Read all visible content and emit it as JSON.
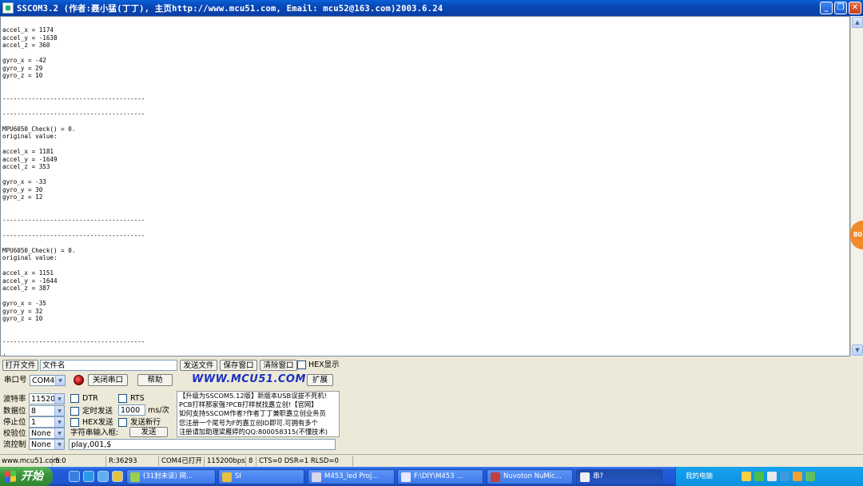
{
  "window": {
    "title": "SSCOM3.2 (作者:聂小猛(丁丁), 主页http://www.mcu51.com,  Email: mcu52@163.com)2003.6.24",
    "minimize": "_",
    "maximize": "❐",
    "close": "✕"
  },
  "output": {
    "text": "accel_x = 1174\naccel_y = -1638\naccel_z = 360\n\ngyro_x = -42\ngyro_y = 29\ngyro_z = 10\n\n\n---------------------------------------\n\n---------------------------------------\n\nMPU6050_Check() = 0.\noriginal value:\n\naccel_x = 1181\naccel_y = -1649\naccel_z = 353\n\ngyro_x = -33\ngyro_y = 30\ngyro_z = 12\n\n\n---------------------------------------\n\n---------------------------------------\n\nMPU6050_Check() = 0.\noriginal value:\n\naccel_x = 1151\naccel_y = -1644\naccel_z = 387\n\ngyro_x = -35\ngyro_y = 32\ngyro_z = 10\n\n\n---------------------------------------\n\n|"
  },
  "side_badge": "80",
  "toolbar": {
    "open_file": "打开文件",
    "file_name_value": "文件名",
    "send_file": "发送文件",
    "save_window": "保存窗口",
    "clear_window": "清除窗口",
    "hex_display": "HEX显示",
    "port_label": "串口号",
    "port_value": "COM4",
    "close_port": "关闭串口",
    "help": "帮助",
    "site_link": "WWW.MCU51.COM",
    "expand": "扩展"
  },
  "settings": {
    "baud_label": "波特率",
    "baud_value": "115200",
    "databits_label": "数据位",
    "databits_value": "8",
    "stopbits_label": "停止位",
    "stopbits_value": "1",
    "parity_label": "校验位",
    "parity_value": "None",
    "flow_label": "流控制",
    "flow_value": "None",
    "dtr": "DTR",
    "rts": "RTS",
    "timed_send": "定时发送",
    "interval_value": "1000",
    "interval_unit": "ms/次",
    "hex_send": "HEX发送",
    "send_newline": "发送新行",
    "input_label": "字符串输入框:",
    "send_button": "发送",
    "input_value": "play,001,$"
  },
  "ad": {
    "lines": [
      "【升级为SSCOM5.12版】新版本USB误拔不死机!",
      "PCB打样那家强?PCB打样就找嘉立创!【官网】",
      "如何支持SSCOM作者?作者丁丁兼职嘉立创业务员",
      "您注册一个尾号为F的嘉立创ID即可.可拥有多个",
      "注册请加助理梁雁婷的QQ:800058315(不懂技术)"
    ]
  },
  "status": {
    "site": "www.mcu51.com",
    "sent": "S:0",
    "received": "R:36293",
    "port_state": "COM4已打开",
    "baud": "115200bps",
    "bits": "8",
    "signals": "CTS=0 DSR=1 RLSD=0"
  },
  "taskbar": {
    "start": "开始",
    "tasks": [
      "(31封未读) 网...",
      "SI",
      "M453_led Proj...",
      "F:\\DIY\\M453 ...",
      "Nuvoton NuMic...",
      "串?"
    ],
    "tray_text": "我的电脑"
  }
}
